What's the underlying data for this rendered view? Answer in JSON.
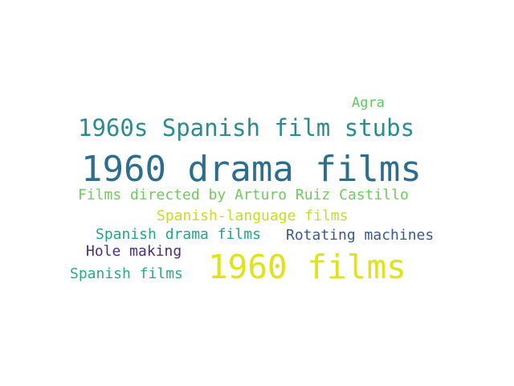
{
  "word_cloud": {
    "words": [
      {
        "id": "agra",
        "text": "Agra",
        "color": "#5ec962"
      },
      {
        "id": "stubs",
        "text": "1960s Spanish film stubs",
        "color": "#2a8c8c"
      },
      {
        "id": "drama",
        "text": "1960 drama films",
        "color": "#2c6e8e"
      },
      {
        "id": "castillo",
        "text": "Films directed by Arturo Ruiz Castillo",
        "color": "#6ccd5a"
      },
      {
        "id": "spanlang",
        "text": "Spanish-language films",
        "color": "#c2df23"
      },
      {
        "id": "spandrama",
        "text": "Spanish drama films",
        "color": "#21a585"
      },
      {
        "id": "rotating",
        "text": "Rotating machines",
        "color": "#3b5a8a"
      },
      {
        "id": "hole",
        "text": "Hole making",
        "color": "#472f7d"
      },
      {
        "id": "1960films",
        "text": "1960 films",
        "color": "#dfe318"
      },
      {
        "id": "spanfilms",
        "text": "Spanish films",
        "color": "#27ad81"
      }
    ]
  }
}
